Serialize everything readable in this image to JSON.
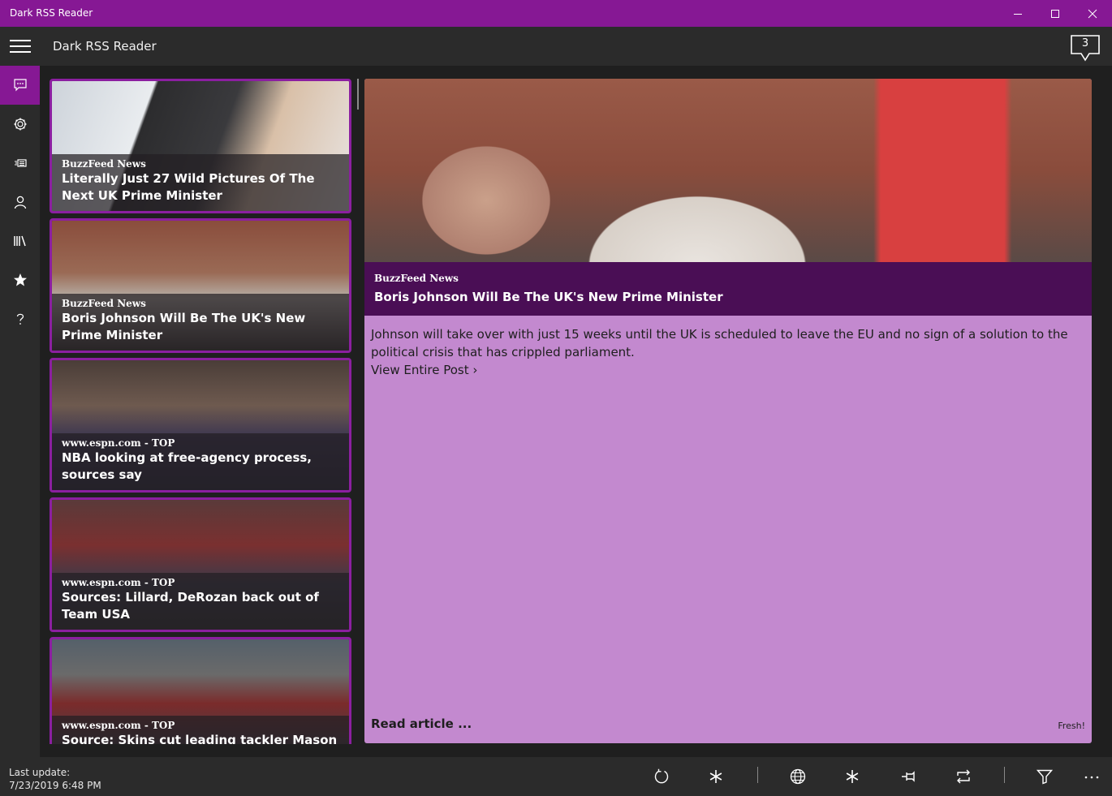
{
  "window": {
    "title": "Dark RSS Reader"
  },
  "header": {
    "title": "Dark RSS Reader",
    "notification_count": "3"
  },
  "nav": {
    "items": [
      {
        "icon": "feed-icon",
        "active": true
      },
      {
        "icon": "gear-icon",
        "active": false
      },
      {
        "icon": "news-icon",
        "active": false
      },
      {
        "icon": "person-icon",
        "active": false
      },
      {
        "icon": "library-icon",
        "active": false
      },
      {
        "icon": "star-icon",
        "active": false
      },
      {
        "icon": "help-icon",
        "active": false
      }
    ]
  },
  "feed": {
    "items": [
      {
        "source": "BuzzFeed News",
        "title": "Literally Just 27 Wild Pictures Of The Next UK Prime Minister"
      },
      {
        "source": "BuzzFeed News",
        "title": "Boris Johnson Will Be The UK's New Prime Minister"
      },
      {
        "source": "www.espn.com - TOP",
        "title": "NBA looking at free-agency process, sources say"
      },
      {
        "source": "www.espn.com - TOP",
        "title": "Sources: Lillard, DeRozan back out of Team USA"
      },
      {
        "source": "www.espn.com - TOP",
        "title": "Source: Skins cut leading tackler Mason"
      }
    ]
  },
  "detail": {
    "source": "BuzzFeed News",
    "title": "Boris Johnson Will Be The UK's New Prime Minister",
    "summary": "Johnson will take over with just 15 weeks until the UK is scheduled to leave the EU and no sign of a solution to the political crisis that has crippled parliament.",
    "view_link": "View Entire Post ›",
    "read_label": "Read article ...",
    "status": "Fresh!"
  },
  "footer": {
    "label": "Last update:",
    "timestamp": "7/23/2019 6:48 PM"
  },
  "colors": {
    "accent": "#861894",
    "card_border": "#8b1fa0",
    "detail_bg": "#c389cf",
    "band": "#4a0e55"
  }
}
